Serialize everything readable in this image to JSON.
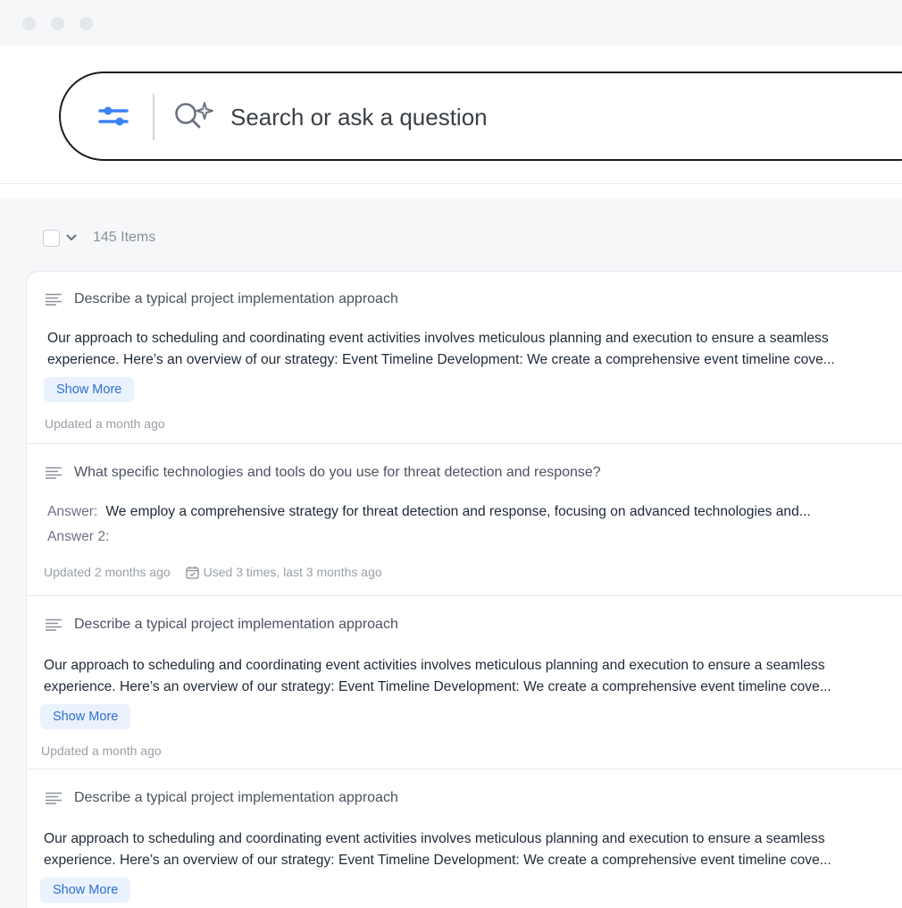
{
  "window": {
    "controls": [
      "close",
      "minimize",
      "maximize"
    ]
  },
  "search": {
    "placeholder": "Search or ask a question",
    "filter_icon": "sliders-icon",
    "search_icon": "ai-search-icon"
  },
  "toolbar": {
    "count_label": "145 Items"
  },
  "cards": [
    {
      "title": "Describe a typical project implementation approach",
      "body_line1": "Our approach to scheduling and coordinating event activities involves meticulous planning and execution to ensure a seamless",
      "body_line2": "experience. Here’s an overview of our strategy: Event Timeline Development: We create a comprehensive event timeline cove...",
      "show_more": "Show More",
      "updated": "Updated a month ago"
    },
    {
      "title": "What specific technologies and tools do you use for threat detection and response?",
      "answer_label": "Answer:",
      "answer_text": "We employ a comprehensive strategy for threat detection and response, focusing on advanced technologies and...",
      "answer2_label": "Answer 2:",
      "updated": "Updated 2 months ago",
      "usage": "Used 3 times, last 3 months ago"
    },
    {
      "title": "Describe a typical project implementation approach",
      "body_line1": "Our approach to scheduling and coordinating event activities involves meticulous planning and execution to ensure a seamless",
      "body_line2": "experience. Here’s an overview of our strategy: Event Timeline Development: We create a comprehensive event timeline cove...",
      "show_more": "Show More",
      "updated": "Updated a month ago"
    },
    {
      "title": "Describe a typical project implementation approach",
      "body_line1": "Our approach to scheduling and coordinating event activities involves meticulous planning and execution to ensure a seamless",
      "body_line2": "experience. Here’s an overview of our strategy: Event Timeline Development: We create a comprehensive event timeline cove...",
      "show_more": "Show More"
    }
  ],
  "colors": {
    "accent": "#3b82f6",
    "show_more_bg": "#eaf2fd",
    "show_more_text": "#2f6fcf",
    "page_bg": "#f6f7f9"
  }
}
